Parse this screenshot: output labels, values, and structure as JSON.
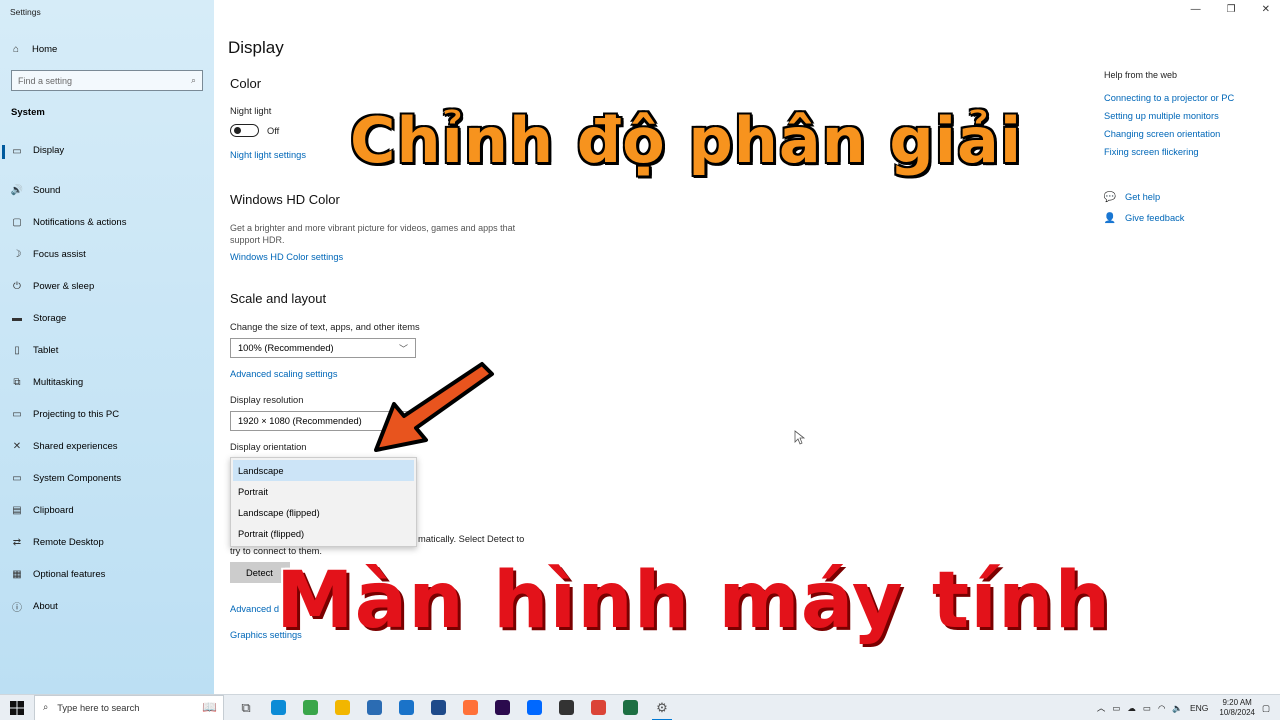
{
  "window": {
    "title": "Settings",
    "minimize": "—",
    "maximize": "❐",
    "close": "✕"
  },
  "sidebar": {
    "home": "Home",
    "search_placeholder": "Find a setting",
    "section": "System",
    "items": [
      {
        "label": "Display",
        "icon": "monitor-icon",
        "glyph": "▭",
        "active": true
      },
      {
        "label": "Sound",
        "icon": "speaker-icon",
        "glyph": "🔊"
      },
      {
        "label": "Notifications & actions",
        "icon": "notification-icon",
        "glyph": "▢"
      },
      {
        "label": "Focus assist",
        "icon": "moon-icon",
        "glyph": "☽"
      },
      {
        "label": "Power & sleep",
        "icon": "power-icon",
        "glyph": "⏻"
      },
      {
        "label": "Storage",
        "icon": "storage-icon",
        "glyph": "▬"
      },
      {
        "label": "Tablet",
        "icon": "tablet-icon",
        "glyph": "▯"
      },
      {
        "label": "Multitasking",
        "icon": "multitasking-icon",
        "glyph": "⧉"
      },
      {
        "label": "Projecting to this PC",
        "icon": "projector-icon",
        "glyph": "▭"
      },
      {
        "label": "Shared experiences",
        "icon": "share-icon",
        "glyph": "✕"
      },
      {
        "label": "System Components",
        "icon": "components-icon",
        "glyph": "▭"
      },
      {
        "label": "Clipboard",
        "icon": "clipboard-icon",
        "glyph": "▤"
      },
      {
        "label": "Remote Desktop",
        "icon": "remote-desktop-icon",
        "glyph": "⇄"
      },
      {
        "label": "Optional features",
        "icon": "features-icon",
        "glyph": "▦"
      },
      {
        "label": "About",
        "icon": "info-icon",
        "glyph": "ⓘ"
      }
    ]
  },
  "main": {
    "title": "Display",
    "color": {
      "heading": "Color",
      "night_light_label": "Night light",
      "night_light_state": "Off",
      "night_light_link": "Night light settings"
    },
    "hdr": {
      "heading": "Windows HD Color",
      "description": "Get a brighter and more vibrant picture for videos, games and apps that support HDR.",
      "link": "Windows HD Color settings"
    },
    "scale": {
      "heading": "Scale and layout",
      "size_label": "Change the size of text, apps, and other items",
      "size_value": "100% (Recommended)",
      "advanced_link": "Advanced scaling settings",
      "resolution_label": "Display resolution",
      "resolution_value": "1920 × 1080 (Recommended)",
      "orientation_label": "Display orientation",
      "orientation_options": [
        "Landscape",
        "Portrait",
        "Landscape (flipped)",
        "Portrait (flipped)"
      ],
      "orientation_selected": "Landscape"
    },
    "multiple": {
      "detect_text_1": "matically. Select Detect to",
      "detect_text_2": "try to connect to them.",
      "detect_button": "Detect",
      "advanced_display_link": "Advanced d",
      "graphics_link": "Graphics settings"
    }
  },
  "help": {
    "heading": "Help from the web",
    "links": [
      "Connecting to a projector or PC",
      "Setting up multiple monitors",
      "Changing screen orientation",
      "Fixing screen flickering"
    ],
    "get_help": "Get help",
    "feedback": "Give feedback"
  },
  "overlay": {
    "top_text": "Chỉnh độ phân giải",
    "bottom_text": "Màn hình máy tính",
    "top_color": "#f7931e",
    "bottom_color": "#e3121a"
  },
  "taskbar": {
    "search_placeholder": "Type here to search",
    "apps": [
      {
        "name": "task-view-icon",
        "color": "#444444",
        "glyph": "⧉"
      },
      {
        "name": "edge-icon",
        "color": "#0c8bd6"
      },
      {
        "name": "app-green-icon",
        "color": "#3aa64a"
      },
      {
        "name": "file-explorer-icon",
        "color": "#f2b600"
      },
      {
        "name": "store-icon",
        "color": "#2b6cb3"
      },
      {
        "name": "mail-icon",
        "color": "#1a73c9"
      },
      {
        "name": "app-blue-icon",
        "color": "#1e4a8a"
      },
      {
        "name": "firefox-icon",
        "color": "#ff7139"
      },
      {
        "name": "premiere-icon",
        "color": "#2b0a4d"
      },
      {
        "name": "zalo-icon",
        "color": "#0068ff"
      },
      {
        "name": "app-dark-icon",
        "color": "#333333"
      },
      {
        "name": "chrome-icon",
        "color": "#db4437"
      },
      {
        "name": "excel-icon",
        "color": "#1d6f42"
      },
      {
        "name": "settings-icon",
        "color": "#555555",
        "glyph": "⚙",
        "active": true
      }
    ],
    "tray": {
      "language": "ENG",
      "time": "9:20 AM",
      "date": "10/8/2024"
    }
  }
}
